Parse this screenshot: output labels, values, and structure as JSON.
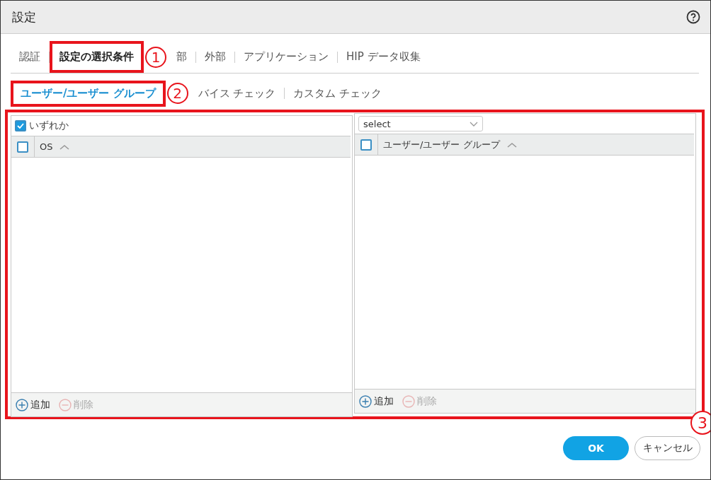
{
  "window": {
    "title": "設定"
  },
  "tabs": [
    {
      "label": "認証",
      "selected": false
    },
    {
      "label": "設定の選択条件",
      "selected": true,
      "callout": "1"
    },
    {
      "label": "部",
      "selected": false
    },
    {
      "label": "外部",
      "selected": false
    },
    {
      "label": "アプリケーション",
      "selected": false
    },
    {
      "label": "HIP データ収集",
      "selected": false
    }
  ],
  "subtabs": [
    {
      "label": "ユーザー/ユーザー グループ",
      "selected": true,
      "callout": "2"
    },
    {
      "label": "バイス チェック",
      "selected": false
    },
    {
      "label": "カスタム チェック",
      "selected": false
    }
  ],
  "panels_callout": "3",
  "left_panel": {
    "any": {
      "label": "いずれか",
      "checked": true
    },
    "header_checked": false,
    "column": "OS",
    "actions": [
      {
        "label": "追加",
        "disabled": false
      },
      {
        "label": "削除",
        "disabled": true
      }
    ]
  },
  "right_panel": {
    "select": {
      "value": "select"
    },
    "header_checked": false,
    "column": "ユーザー/ユーザー グループ",
    "actions": [
      {
        "label": "追加",
        "disabled": false
      },
      {
        "label": "削除",
        "disabled": true
      }
    ]
  },
  "buttons": [
    {
      "label": "OK",
      "kind": "primary"
    },
    {
      "label": "キャンセル",
      "kind": "secondary"
    }
  ]
}
